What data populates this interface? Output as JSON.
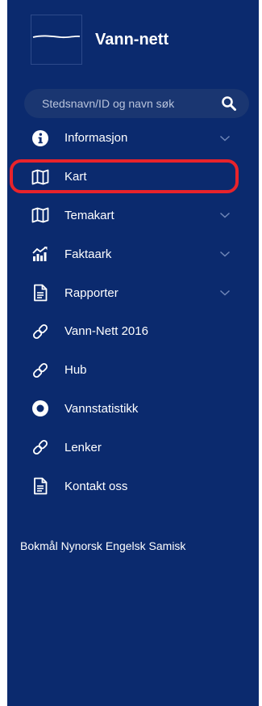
{
  "app": {
    "name": "Vann-nett"
  },
  "search": {
    "placeholder": "Stedsnavn/ID og navn søk",
    "icon": "search-icon"
  },
  "menu": {
    "items": [
      {
        "label": "Informasjon",
        "icon": "info-circle-icon",
        "has_submenu": true
      },
      {
        "label": "Kart",
        "icon": "map-icon",
        "has_submenu": false,
        "highlighted": true
      },
      {
        "label": "Temakart",
        "icon": "map-icon",
        "has_submenu": true
      },
      {
        "label": "Faktaark",
        "icon": "chart-icon",
        "has_submenu": true
      },
      {
        "label": "Rapporter",
        "icon": "document-icon",
        "has_submenu": true
      },
      {
        "label": "Vann-Nett 2016",
        "icon": "link-icon",
        "has_submenu": false
      },
      {
        "label": "Hub",
        "icon": "link-icon",
        "has_submenu": false
      },
      {
        "label": "Vannstatistikk",
        "icon": "circle-icon",
        "has_submenu": false
      },
      {
        "label": "Lenker",
        "icon": "link-icon",
        "has_submenu": false
      },
      {
        "label": "Kontakt oss",
        "icon": "document-icon",
        "has_submenu": false
      }
    ]
  },
  "languages": [
    "Bokmål",
    "Nynorsk",
    "Engelsk",
    "Samisk"
  ],
  "colors": {
    "sidebar_background": "#0b2a6e",
    "search_background": "#1a3671",
    "highlight": "#e8232b",
    "text": "#ffffff"
  }
}
